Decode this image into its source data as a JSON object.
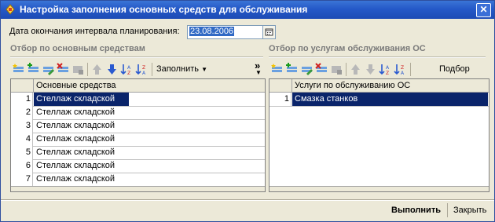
{
  "window": {
    "title": "Настройка заполнения основных средств для обслуживания",
    "close_symbol": "✕"
  },
  "date_field": {
    "label": "Дата окончания интервала планирования:",
    "value": "23.08.2006"
  },
  "left_panel": {
    "group_title": "Отбор по основным средствам",
    "fill_label": "Заполнить",
    "more_symbol": "»",
    "column_header": "Основные средства",
    "rows": [
      {
        "num": "1",
        "text": "Стеллаж складской"
      },
      {
        "num": "2",
        "text": "Стеллаж складской"
      },
      {
        "num": "3",
        "text": "Стеллаж складской"
      },
      {
        "num": "4",
        "text": "Стеллаж складской"
      },
      {
        "num": "5",
        "text": "Стеллаж складской"
      },
      {
        "num": "6",
        "text": "Стеллаж складской"
      },
      {
        "num": "7",
        "text": "Стеллаж складской"
      }
    ]
  },
  "right_panel": {
    "group_title": "Отбор по услугам обслуживания ОС",
    "pick_label": "Подбор",
    "column_header": "Услуги по обслуживанию ОС",
    "rows": [
      {
        "num": "1",
        "text": "Смазка станков"
      }
    ]
  },
  "buttons": {
    "execute": "Выполнить",
    "close": "Закрыть"
  },
  "colors": {
    "title_bar": "#2559c8",
    "selection": "#0a246a",
    "face": "#ece9d8"
  }
}
